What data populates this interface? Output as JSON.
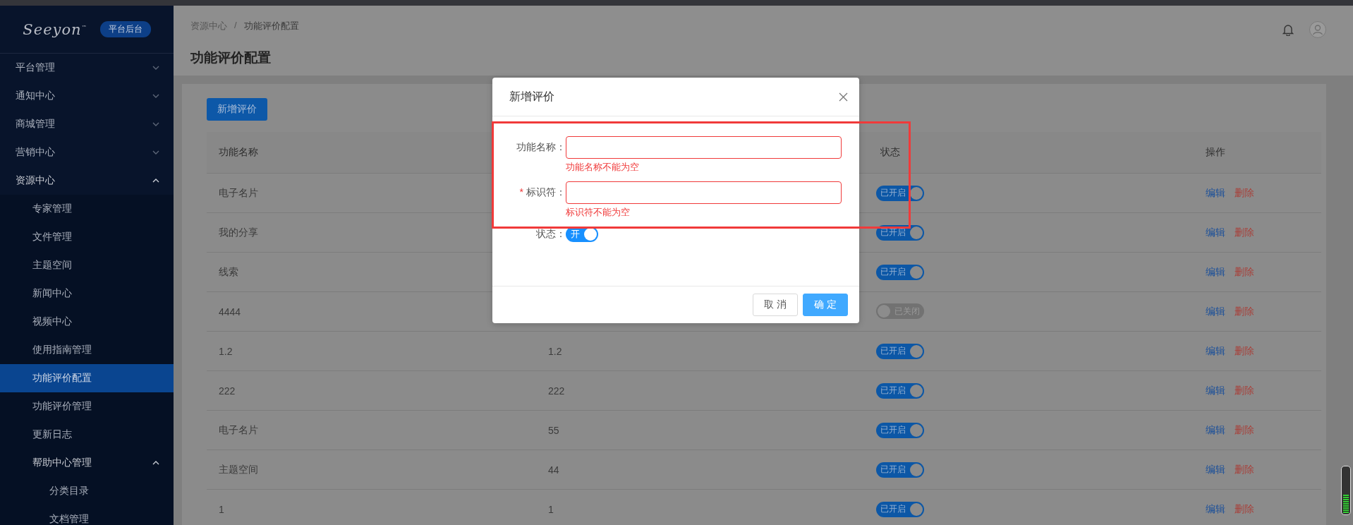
{
  "sidebar": {
    "logo": {
      "text": "Seeyon",
      "mark": "™"
    },
    "badge": "平台后台",
    "items": [
      {
        "label": "平台管理",
        "expanded": false,
        "selected": false
      },
      {
        "label": "通知中心",
        "expanded": false,
        "selected": false
      },
      {
        "label": "商城管理",
        "expanded": false,
        "selected": false
      },
      {
        "label": "营销中心",
        "expanded": false,
        "selected": false
      },
      {
        "label": "资源中心",
        "expanded": true,
        "selected": false,
        "children": [
          {
            "label": "专家管理",
            "selected": false
          },
          {
            "label": "文件管理",
            "selected": false
          },
          {
            "label": "主题空间",
            "selected": false
          },
          {
            "label": "新闻中心",
            "selected": false
          },
          {
            "label": "视频中心",
            "selected": false
          },
          {
            "label": "使用指南管理",
            "selected": false
          },
          {
            "label": "功能评价配置",
            "selected": true
          },
          {
            "label": "功能评价管理",
            "selected": false
          },
          {
            "label": "更新日志",
            "selected": false
          },
          {
            "label": "帮助中心管理",
            "expanded": true,
            "selected": false,
            "children": [
              {
                "label": "分类目录",
                "selected": false
              },
              {
                "label": "文档管理",
                "selected": false
              }
            ]
          }
        ]
      }
    ]
  },
  "breadcrumb": {
    "items": [
      "资源中心",
      "功能评价配置"
    ],
    "separator": "/"
  },
  "page_title": "功能评价配置",
  "add_button": "新增评价",
  "table": {
    "columns": [
      "功能名称",
      null,
      "状态",
      "操作"
    ],
    "rows": [
      {
        "name": "电子名片",
        "status": {
          "on": true,
          "label": "已开启"
        },
        "actions": [
          "编辑",
          "删除"
        ]
      },
      {
        "name": "我的分享",
        "status": {
          "on": true,
          "label": "已开启"
        },
        "actions": [
          "编辑",
          "删除"
        ]
      },
      {
        "name": "线索",
        "status": {
          "on": true,
          "label": "已开启"
        },
        "actions": [
          "编辑",
          "删除"
        ]
      },
      {
        "name": "4444",
        "status": {
          "on": false,
          "label": "已关闭"
        },
        "actions": [
          "编辑",
          "删除"
        ]
      },
      {
        "name": "1.2",
        "identifier": "1.2",
        "status": {
          "on": true,
          "label": "已开启"
        },
        "actions": [
          "编辑",
          "删除"
        ]
      },
      {
        "name": "222",
        "identifier": "222",
        "status": {
          "on": true,
          "label": "已开启"
        },
        "actions": [
          "编辑",
          "删除"
        ]
      },
      {
        "name": "电子名片",
        "identifier": "55",
        "status": {
          "on": true,
          "label": "已开启"
        },
        "actions": [
          "编辑",
          "删除"
        ]
      },
      {
        "name": "主题空间",
        "identifier": "44",
        "status": {
          "on": true,
          "label": "已开启"
        },
        "actions": [
          "编辑",
          "删除"
        ]
      },
      {
        "name": "1",
        "identifier": "1",
        "status": {
          "on": true,
          "label": "已开启"
        },
        "actions": [
          "编辑",
          "删除"
        ]
      }
    ]
  },
  "dialog": {
    "title": "新增评价",
    "fields": [
      {
        "label": "功能名称：",
        "error": "功能名称不能为空"
      },
      {
        "label": "标识符：",
        "required_mark": "*",
        "error": "标识符不能为空"
      }
    ],
    "status": {
      "label": "状态：",
      "on": true,
      "text": "开"
    },
    "buttons": [
      "取 消",
      "确 定"
    ]
  }
}
